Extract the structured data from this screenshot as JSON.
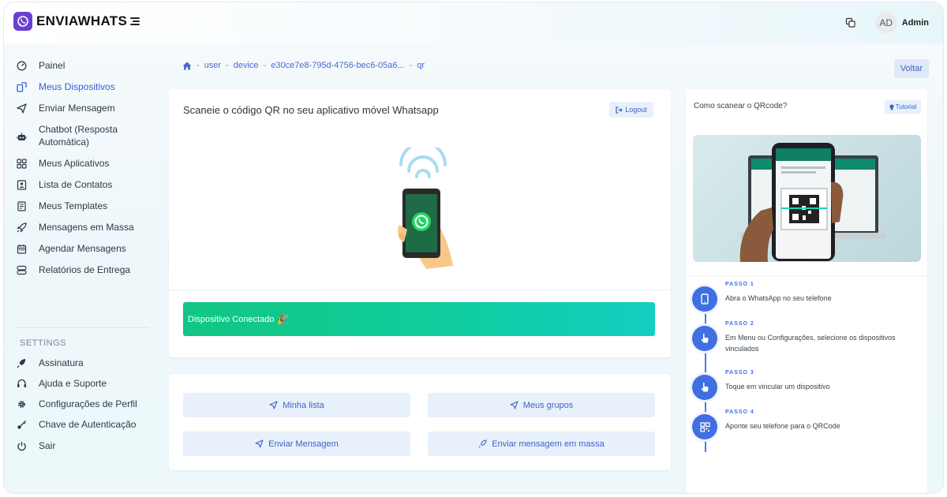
{
  "app": {
    "name": "ENVIAWHATS"
  },
  "header": {
    "avatar_initials": "AD",
    "user_name": "Admin"
  },
  "sidebar": {
    "items": [
      {
        "label": "Painel",
        "icon": "dashboard-icon"
      },
      {
        "label": "Meus Dispositivos",
        "icon": "device-icon",
        "active": true
      },
      {
        "label": "Enviar Mensagem",
        "icon": "send-icon"
      },
      {
        "label": "Chatbot (Resposta Automática)",
        "icon": "robot-icon"
      },
      {
        "label": "Meus Aplicativos",
        "icon": "apps-icon"
      },
      {
        "label": "Lista de Contatos",
        "icon": "contacts-icon"
      },
      {
        "label": "Meus Templates",
        "icon": "template-icon"
      },
      {
        "label": "Mensagens em Massa",
        "icon": "rocket-icon"
      },
      {
        "label": "Agendar Mensagens",
        "icon": "calendar-icon"
      },
      {
        "label": "Relatórios de Entrega",
        "icon": "report-icon"
      }
    ],
    "settings_title": "SETTINGS",
    "settings_items": [
      {
        "label": "Assinatura",
        "icon": "subscription-icon"
      },
      {
        "label": "Ajuda e Suporte",
        "icon": "support-icon"
      },
      {
        "label": "Configurações de Perfil",
        "icon": "gear-icon"
      },
      {
        "label": "Chave de Autenticação",
        "icon": "key-icon"
      },
      {
        "label": "Sair",
        "icon": "power-icon"
      }
    ]
  },
  "breadcrumb": [
    "user",
    "device",
    "e30ce7e8-795d-4756-bec6-05a6...",
    "qr"
  ],
  "back_button": "Voltar",
  "qr_card": {
    "title": "Scaneie o código QR no seu aplicativo móvel Whatsapp",
    "logout_label": "Logout",
    "status_text": "Dispositivo Conectado",
    "status_emoji": "🎉"
  },
  "actions": {
    "my_list": "Minha lista",
    "my_groups": "Meus grupos",
    "send_message": "Enviar Mensagem",
    "send_bulk": "Enviar mensagem em massa"
  },
  "help_card": {
    "title": "Como scanear o QRcode?",
    "tutorial_label": "Tutorial",
    "steps": [
      {
        "title": "PASSO 1",
        "text": "Abra o WhatsApp no seu telefone"
      },
      {
        "title": "PASSO 2",
        "text": "Em Menu ou Configurações, selecione os dispositivos vinculados"
      },
      {
        "title": "PASSO 3",
        "text": "Toque em vincular um dispositivo"
      },
      {
        "title": "PASSO 4",
        "text": "Aponte seu telefone para o QRCode"
      }
    ]
  },
  "colors": {
    "brand": "#6b3fd4",
    "accent": "#3f6fe0",
    "success_start": "#12c583",
    "success_end": "#12cfc2"
  }
}
